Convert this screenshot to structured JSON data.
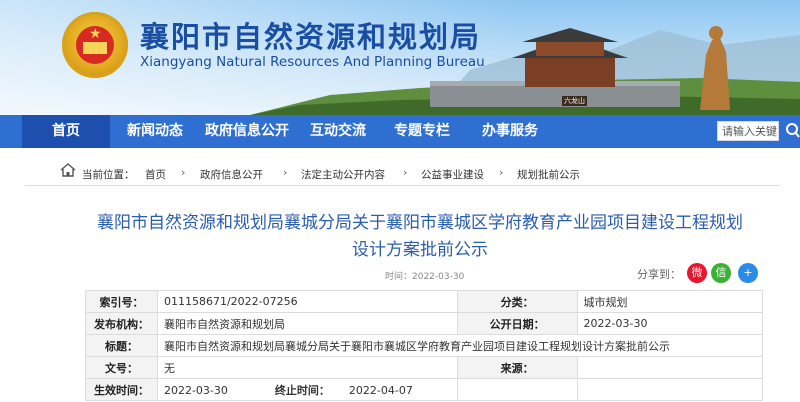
{
  "header": {
    "title": "襄阳市自然资源和规划局",
    "subtitle": "Xiangyang Natural Resources And Planning Bureau",
    "scene_label": "六龙山"
  },
  "nav": {
    "items": [
      {
        "label": "首页",
        "active": true
      },
      {
        "label": "新闻动态",
        "active": false
      },
      {
        "label": "政府信息公开",
        "active": false
      },
      {
        "label": "互动交流",
        "active": false
      },
      {
        "label": "专题专栏",
        "active": false
      },
      {
        "label": "办事服务",
        "active": false
      }
    ],
    "search_placeholder": "请输入关键"
  },
  "breadcrumb": {
    "prefix": "当前位置：",
    "items": [
      "首页",
      "政府信息公开",
      "法定主动公开内容",
      "公益事业建设",
      "规划批前公示"
    ]
  },
  "article": {
    "title_line1": "襄阳市自然资源和规划局襄城分局关于襄阳市襄城区学府教育产业园项目建设工程规划",
    "title_line2": "设计方案批前公示",
    "time": "时间：2022-03-30",
    "share_label": "分享到："
  },
  "meta": {
    "index_label": "索引号：",
    "index_value": "011158671/2022-07256",
    "category_label": "分类：",
    "category_value": "城市规划",
    "org_label": "发布机构：",
    "org_value": "襄阳市自然资源和规划局",
    "pubdate_label": "公开日期：",
    "pubdate_value": "2022-03-30",
    "title_label": "标题：",
    "title_value": "襄阳市自然资源和规划局襄城分局关于襄阳市襄城区学府教育产业园项目建设工程规划设计方案批前公示",
    "docno_label": "文号：",
    "docno_value": "无",
    "source_label": "来源：",
    "source_value": "",
    "effective_label": "生效时间：",
    "effective_value": "2022-03-30",
    "end_label": "终止时间：",
    "end_value": "2022-04-07"
  },
  "colors": {
    "nav": "#2f6fd1",
    "nav_active": "#1c4fae",
    "title": "#2a5db0",
    "header_title": "#1a4ea3"
  }
}
